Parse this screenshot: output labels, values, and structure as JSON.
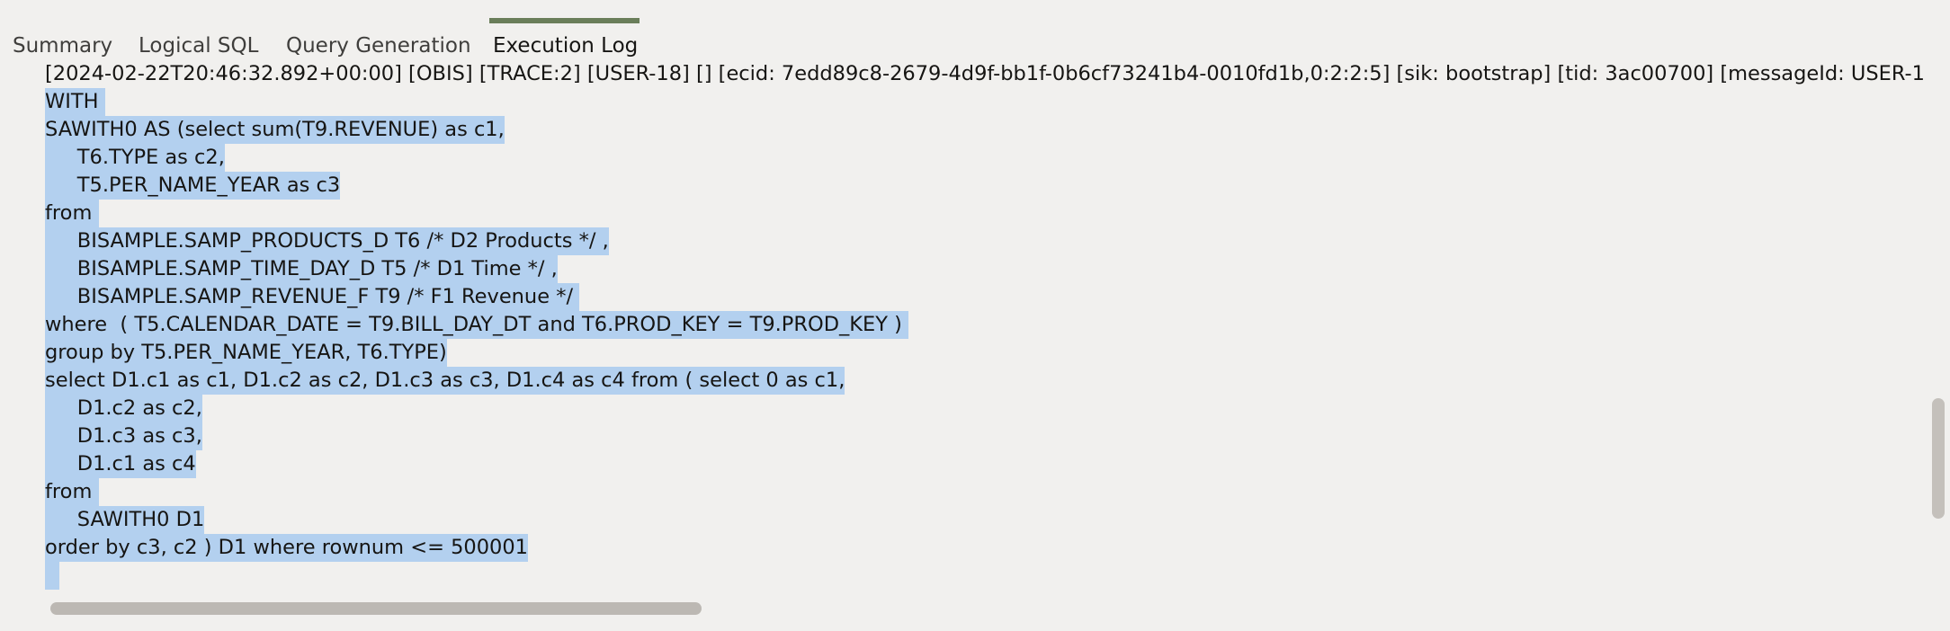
{
  "tabs": [
    {
      "label": "Summary"
    },
    {
      "label": "Logical SQL"
    },
    {
      "label": "Query Generation"
    },
    {
      "label": "Execution Log"
    }
  ],
  "active_tab": "Execution Log",
  "log_header": "[2024-02-22T20:46:32.892+00:00] [OBIS] [TRACE:2] [USER-18] [] [ecid: 7edd89c8-2679-4d9f-bb1f-0b6cf73241b4-0010fd1b,0:2:2:5] [sik: bootstrap] [tid: 3ac00700] [messageId: USER-1",
  "log_lines": [
    "WITH ",
    "SAWITH0 AS (select sum(T9.REVENUE) as c1,",
    "     T6.TYPE as c2,",
    "     T5.PER_NAME_YEAR as c3",
    "from ",
    "     BISAMPLE.SAMP_PRODUCTS_D T6 /* D2 Products */ ,",
    "     BISAMPLE.SAMP_TIME_DAY_D T5 /* D1 Time */ ,",
    "     BISAMPLE.SAMP_REVENUE_F T9 /* F1 Revenue */ ",
    "where  ( T5.CALENDAR_DATE = T9.BILL_DAY_DT and T6.PROD_KEY = T9.PROD_KEY ) ",
    "group by T5.PER_NAME_YEAR, T6.TYPE)",
    "select D1.c1 as c1, D1.c2 as c2, D1.c3 as c3, D1.c4 as c4 from ( select 0 as c1,",
    "     D1.c2 as c2,",
    "     D1.c3 as c3,",
    "     D1.c1 as c4",
    "from ",
    "     SAWITH0 D1",
    "order by c3, c2 ) D1 where rownum <= 500001"
  ],
  "colors": {
    "background": "#f1f0ee",
    "selection": "#b3d0ef",
    "active_tab_indicator": "#6a7e5a",
    "text": "#161513"
  }
}
